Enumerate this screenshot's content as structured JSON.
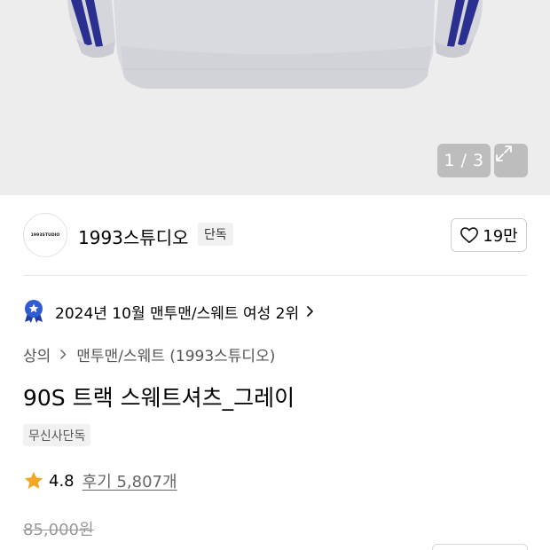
{
  "gallery": {
    "counter_text": "1 / 3",
    "background_color": "#ededed",
    "garment_color": "#d7d8de",
    "stripe_color": "#2b2f8f"
  },
  "brand": {
    "logo_text": "1993STUDIO",
    "name": "1993스튜디오",
    "exclusive_label": "단독",
    "like_count": "19만"
  },
  "ranking": {
    "text": "2024년 10월 맨투맨/스웨트 여성 2위",
    "medal_color": "#2f5bd3"
  },
  "breadcrumb": {
    "category": "상의",
    "subcategory": "맨투맨/스웨트 (1993스튜디오)"
  },
  "product": {
    "title": "90S 트랙 스웨트셔츠_그레이",
    "store_tag": "무신사단독",
    "rating": "4.8",
    "review_text": "후기 5,807개",
    "original_price": "85,000원",
    "star_color": "#f3a623"
  }
}
